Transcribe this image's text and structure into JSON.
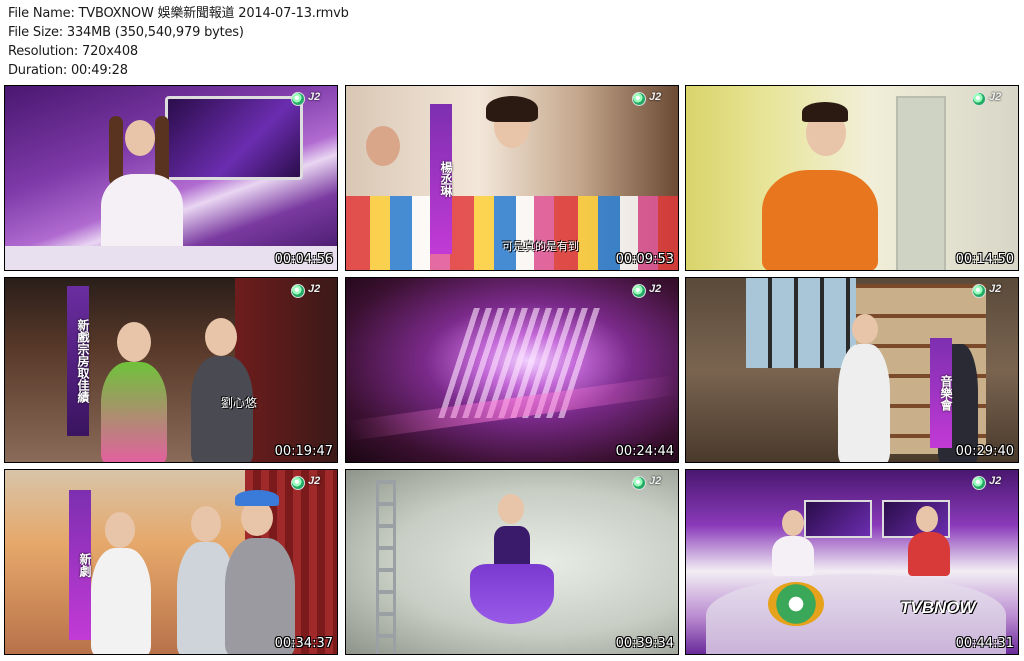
{
  "info": {
    "file_name": "File Name: TVBOXNOW 娛樂新聞報道 2014-07-13.rmvb",
    "file_size": "File Size: 334MB (350,540,979 bytes)",
    "resolution": "Resolution: 720x408",
    "duration": "Duration: 00:49:28"
  },
  "thumbnails": [
    {
      "timestamp": "00:04:56"
    },
    {
      "timestamp": "00:09:53",
      "subtitle": "可是真的是有到"
    },
    {
      "timestamp": "00:14:50"
    },
    {
      "timestamp": "00:19:47",
      "name_caption": "劉心悠"
    },
    {
      "timestamp": "00:24:44"
    },
    {
      "timestamp": "00:29:40"
    },
    {
      "timestamp": "00:34:37"
    },
    {
      "timestamp": "00:39:34"
    },
    {
      "timestamp": "00:44:31",
      "watermark": "TVBNOW"
    }
  ],
  "colors": {
    "studio_purple": "#6a2a9a",
    "accent_magenta": "#c23ad6",
    "text": "#1a1a1a"
  }
}
